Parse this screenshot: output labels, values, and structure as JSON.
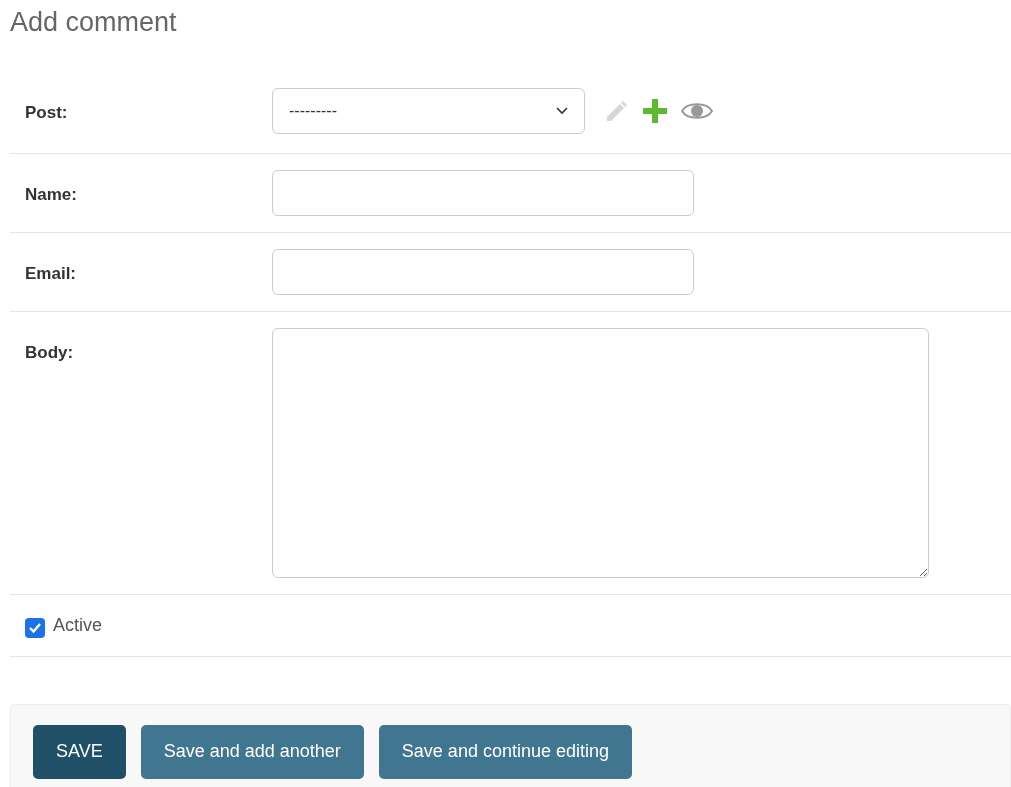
{
  "title": "Add comment",
  "fields": [
    {
      "kind": "select",
      "label": "Post:",
      "value": "---------",
      "edit_disabled": true
    },
    {
      "kind": "text",
      "label": "Name:"
    },
    {
      "kind": "text",
      "label": "Email:"
    },
    {
      "kind": "textarea",
      "label": "Body:"
    },
    {
      "kind": "checkbox",
      "label": "Active",
      "checked": true
    }
  ],
  "buttons": [
    {
      "label": "SAVE",
      "kind": "primary"
    },
    {
      "label": "Save and add another",
      "kind": "secondary"
    },
    {
      "label": "Save and continue editing",
      "kind": "secondary"
    }
  ]
}
